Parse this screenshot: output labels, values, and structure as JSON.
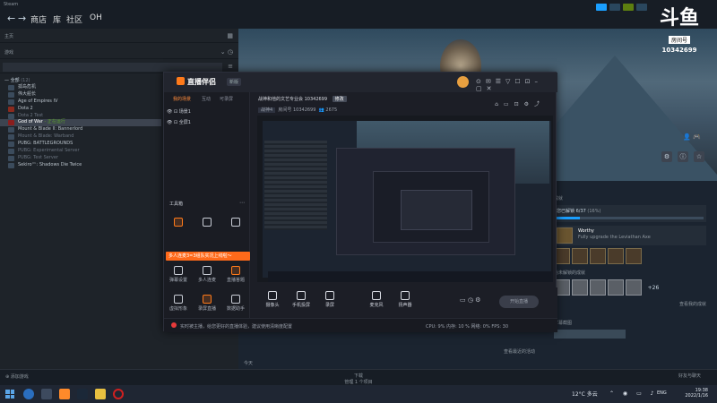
{
  "steam": {
    "menu": "Steam",
    "nav_tabs": [
      "商店",
      "库",
      "社区",
      "OH"
    ],
    "home_label": "主页",
    "filter_label": "游戏",
    "search_placeholder": "",
    "category": "— 全部",
    "category_count": "(12)",
    "games": [
      {
        "name": "孤岛危机",
        "state": ""
      },
      {
        "name": "伟大船长",
        "state": ""
      },
      {
        "name": "Age of Empires IV",
        "state": ""
      },
      {
        "name": "Dota 2",
        "state": ""
      },
      {
        "name": "Dota 2 Test",
        "state": "muted"
      },
      {
        "name": "God of War",
        "status": "- 正在运行",
        "state": "active"
      },
      {
        "name": "Mount & Blade II: Bannerlord",
        "state": ""
      },
      {
        "name": "Mount & Blade: Warband",
        "state": "muted"
      },
      {
        "name": "PUBG: BATTLEGROUNDS",
        "state": ""
      },
      {
        "name": "PUBG: Experimental Server",
        "state": "muted"
      },
      {
        "name": "PUBG: Test Server",
        "state": "muted"
      },
      {
        "name": "Sekiro™: Shadows Die Twice",
        "state": ""
      }
    ],
    "achievements": {
      "title": "成就",
      "progress_label": "您已解锁 6/37",
      "progress_pct": "(16%)",
      "progress_fraction": 0.16,
      "featured_name": "Worthy",
      "featured_desc": "Fully upgrade the Leviathan Axe",
      "locked_title": "尚未解锁的成就",
      "more": "+26",
      "view_all": "查看我的成就"
    },
    "screenshots_label": "屏幕截图",
    "today_label": "今天",
    "view_link": "查看最近的活动",
    "footer": {
      "add_game": "添加游戏",
      "downloads": "下载",
      "downloads_sub": "管理 1 个项目",
      "friends": "好友与聊天"
    }
  },
  "douyu": {
    "logo": "斗鱼",
    "room_label": "房间号",
    "room_number": "10342699"
  },
  "app": {
    "name": "直播伴侣",
    "version": "新版",
    "tabs": [
      "我的场景",
      "互动",
      "可录屏"
    ],
    "scenes": [
      "场景1",
      "全屏1"
    ],
    "room_title": "战神和他的文艺专业会 10342699",
    "room_tag": "修改",
    "room_category": "战神4",
    "room_line2": "房间号 10342699",
    "room_viewers": "2675",
    "toolbox": "工具箱",
    "banner_text": "多人连麦3=3组队实况上线啦～",
    "tools": [
      "弹幕设置",
      "多人连麦",
      "直播答题",
      "虚拟形象",
      "录屏直播",
      "数据助手"
    ],
    "bottom": [
      "摄像头",
      "手机投屏",
      "录屏",
      "麦克风",
      "扬声器"
    ],
    "start_button": "开始直播",
    "status_text": "实时被主播，给您更好的直播体验，建议使用清晰度配置",
    "stats": "CPU: 9%   内存: 10 %   网络: 0%   FPS: 30"
  },
  "taskbar": {
    "temp": "12°C 多云",
    "lang": "ENG",
    "time": "19:38",
    "date": "2022/1/16"
  }
}
